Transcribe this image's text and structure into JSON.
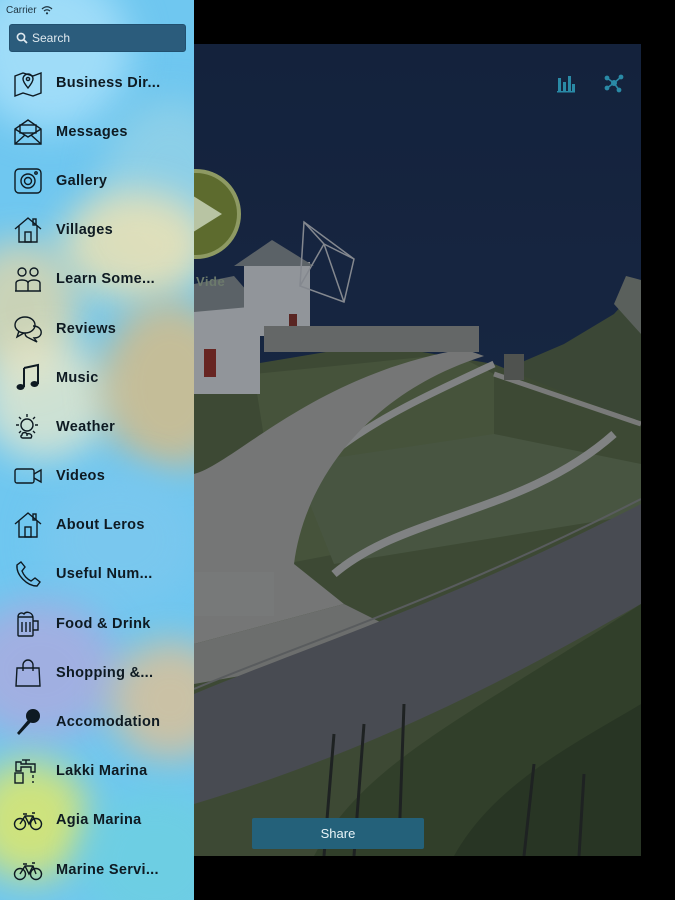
{
  "status": {
    "carrier": "Carrier"
  },
  "search": {
    "placeholder": "Search"
  },
  "menu": {
    "items": [
      {
        "label": "Business Dir...",
        "icon": "map-pin-icon"
      },
      {
        "label": "Messages",
        "icon": "envelope-icon"
      },
      {
        "label": "Gallery",
        "icon": "camera-icon"
      },
      {
        "label": "Villages",
        "icon": "home-icon"
      },
      {
        "label": "Learn Some...",
        "icon": "people-icon"
      },
      {
        "label": "Reviews",
        "icon": "chat-bubbles-icon"
      },
      {
        "label": "Music",
        "icon": "music-note-icon"
      },
      {
        "label": "Weather",
        "icon": "weather-icon"
      },
      {
        "label": "Videos",
        "icon": "video-camera-icon"
      },
      {
        "label": "About Leros",
        "icon": "home-icon"
      },
      {
        "label": "Useful Num...",
        "icon": "phone-icon"
      },
      {
        "label": "Food & Drink",
        "icon": "beer-mug-icon"
      },
      {
        "label": "Shopping &...",
        "icon": "shopping-bag-icon"
      },
      {
        "label": "Accomodation",
        "icon": "microphone-icon"
      },
      {
        "label": "Lakki Marina",
        "icon": "faucet-icon"
      },
      {
        "label": "Agia Marina",
        "icon": "bicycle-icon"
      },
      {
        "label": "Marine Servi...",
        "icon": "bicycle-icon"
      }
    ]
  },
  "main": {
    "play_label": "Vide",
    "share_label": "Share",
    "top_icons": [
      "bar-chart-icon",
      "share-network-icon"
    ]
  },
  "colors": {
    "sidebar_bg": "#6fc7f0",
    "accent_teal": "#2a8aa6",
    "share_button": "#24617a"
  }
}
